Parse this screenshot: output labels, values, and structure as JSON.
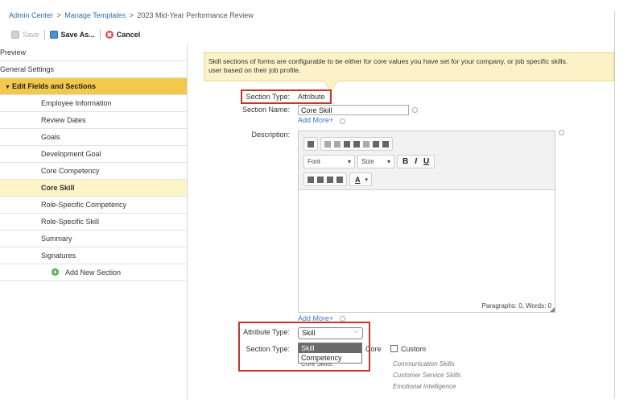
{
  "breadcrumb": {
    "items": [
      "Admin Center",
      "Manage Templates",
      "2023 Mid-Year Performance Review"
    ],
    "separator": ">"
  },
  "toolbar": {
    "save_label": "Save",
    "save_as_label": "Save As...",
    "cancel_label": "Cancel"
  },
  "sidebar": {
    "preview": "Preview",
    "general_settings": "General Settings",
    "edit_fields": "Edit Fields and Sections",
    "items": [
      "Employee Information",
      "Review Dates",
      "Goals",
      "Development Goal",
      "Core Competency",
      "Core Skill",
      "Role-Specific Competency",
      "Role-Specific Skill",
      "Summary",
      "Signatures"
    ],
    "active_item": "Core Skill",
    "add_new_section": "Add New Section"
  },
  "info": {
    "text_line1": "Skill sections of forms are configurable to be either for core values you have set for your company, or job specific skills.",
    "text_line2": "user based on their job profile."
  },
  "form": {
    "section_type_label": "Section Type:",
    "section_type_value": "Attribute",
    "section_name_label": "Section Name:",
    "section_name_value": "Core Skill",
    "add_more": "Add More+",
    "description_label": "Description:",
    "editor": {
      "font_label": "Font",
      "size_label": "Size",
      "bold": "B",
      "italic": "I",
      "underline": "U",
      "color": "A",
      "status": "Paragraphs: 0, Words: 0"
    },
    "add_more_2": "Add More+",
    "attribute_type_label": "Attribute Type:",
    "attribute_type_value": "Skill",
    "attribute_type_options": [
      "Skill",
      "Competency"
    ],
    "section_type2_label": "Section Type:",
    "core_label": "Core",
    "custom_label": "Custom",
    "core_skills_label": "Core Skills:",
    "core_skills": [
      "Communication Skills",
      "Customer Service Skills",
      "Emotional Intelligence"
    ]
  }
}
